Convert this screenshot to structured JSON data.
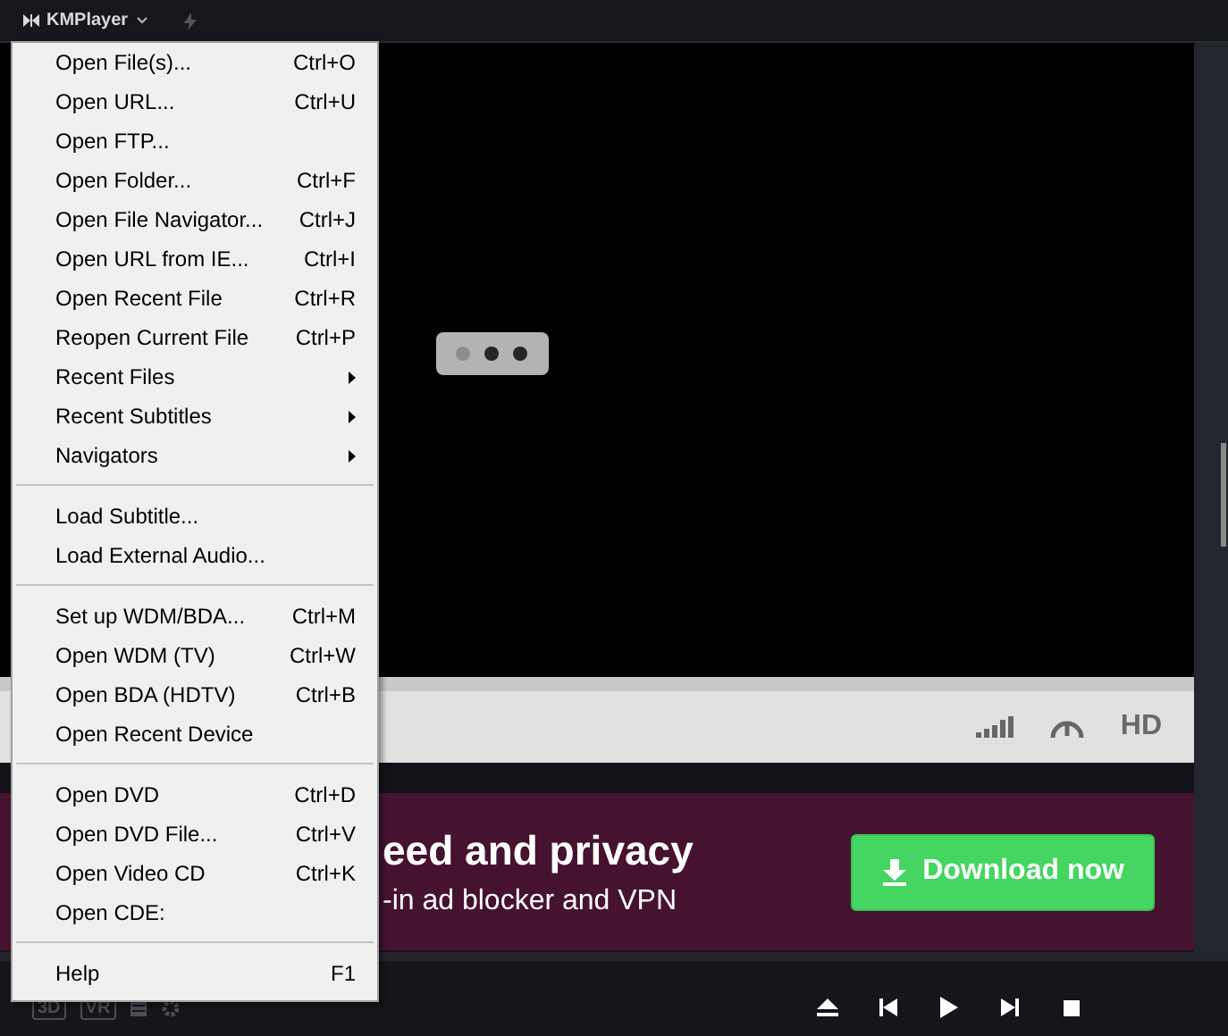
{
  "title_bar": {
    "app_name": "KMPlayer"
  },
  "menu": [
    {
      "kind": "item",
      "label": "Open File(s)...",
      "shortcut": "Ctrl+O",
      "has_submenu": false
    },
    {
      "kind": "item",
      "label": "Open URL...",
      "shortcut": "Ctrl+U",
      "has_submenu": false
    },
    {
      "kind": "item",
      "label": "Open FTP...",
      "has_submenu": false
    },
    {
      "kind": "item",
      "label": "Open Folder...",
      "shortcut": "Ctrl+F",
      "has_submenu": false
    },
    {
      "kind": "item",
      "label": "Open File Navigator...",
      "shortcut": "Ctrl+J",
      "has_submenu": false
    },
    {
      "kind": "item",
      "label": "Open URL from IE...",
      "shortcut": "Ctrl+I",
      "has_submenu": false
    },
    {
      "kind": "item",
      "label": "Open Recent File",
      "shortcut": "Ctrl+R",
      "has_submenu": false
    },
    {
      "kind": "item",
      "label": "Reopen Current File",
      "shortcut": "Ctrl+P",
      "has_submenu": false
    },
    {
      "kind": "item",
      "label": "Recent Files",
      "has_submenu": true
    },
    {
      "kind": "item",
      "label": "Recent Subtitles",
      "has_submenu": true
    },
    {
      "kind": "item",
      "label": "Navigators",
      "has_submenu": true
    },
    {
      "kind": "separator"
    },
    {
      "kind": "item",
      "label": "Load Subtitle...",
      "has_submenu": false
    },
    {
      "kind": "item",
      "label": "Load External Audio...",
      "has_submenu": false
    },
    {
      "kind": "separator"
    },
    {
      "kind": "item",
      "label": "Set up WDM/BDA...",
      "shortcut": "Ctrl+M",
      "has_submenu": false
    },
    {
      "kind": "item",
      "label": "Open WDM (TV)",
      "shortcut": "Ctrl+W",
      "has_submenu": false
    },
    {
      "kind": "item",
      "label": "Open BDA (HDTV)",
      "shortcut": "Ctrl+B",
      "has_submenu": false
    },
    {
      "kind": "item",
      "label": "Open Recent Device",
      "has_submenu": false
    },
    {
      "kind": "separator"
    },
    {
      "kind": "item",
      "label": "Open DVD",
      "shortcut": "Ctrl+D",
      "has_submenu": false
    },
    {
      "kind": "item",
      "label": "Open DVD File...",
      "shortcut": "Ctrl+V",
      "has_submenu": false
    },
    {
      "kind": "item",
      "label": "Open Video CD",
      "shortcut": "Ctrl+K",
      "has_submenu": false
    },
    {
      "kind": "item",
      "label": "Open CDE:",
      "has_submenu": false
    },
    {
      "kind": "separator"
    },
    {
      "kind": "item",
      "label": "Help",
      "shortcut": "F1",
      "has_submenu": false
    }
  ],
  "info_bar": {
    "quality": "HD"
  },
  "ad": {
    "headline": "eed and privacy",
    "subline": "-in ad blocker and VPN",
    "button": "Download now"
  },
  "controls": {
    "left": [
      "3D",
      "VR"
    ]
  }
}
